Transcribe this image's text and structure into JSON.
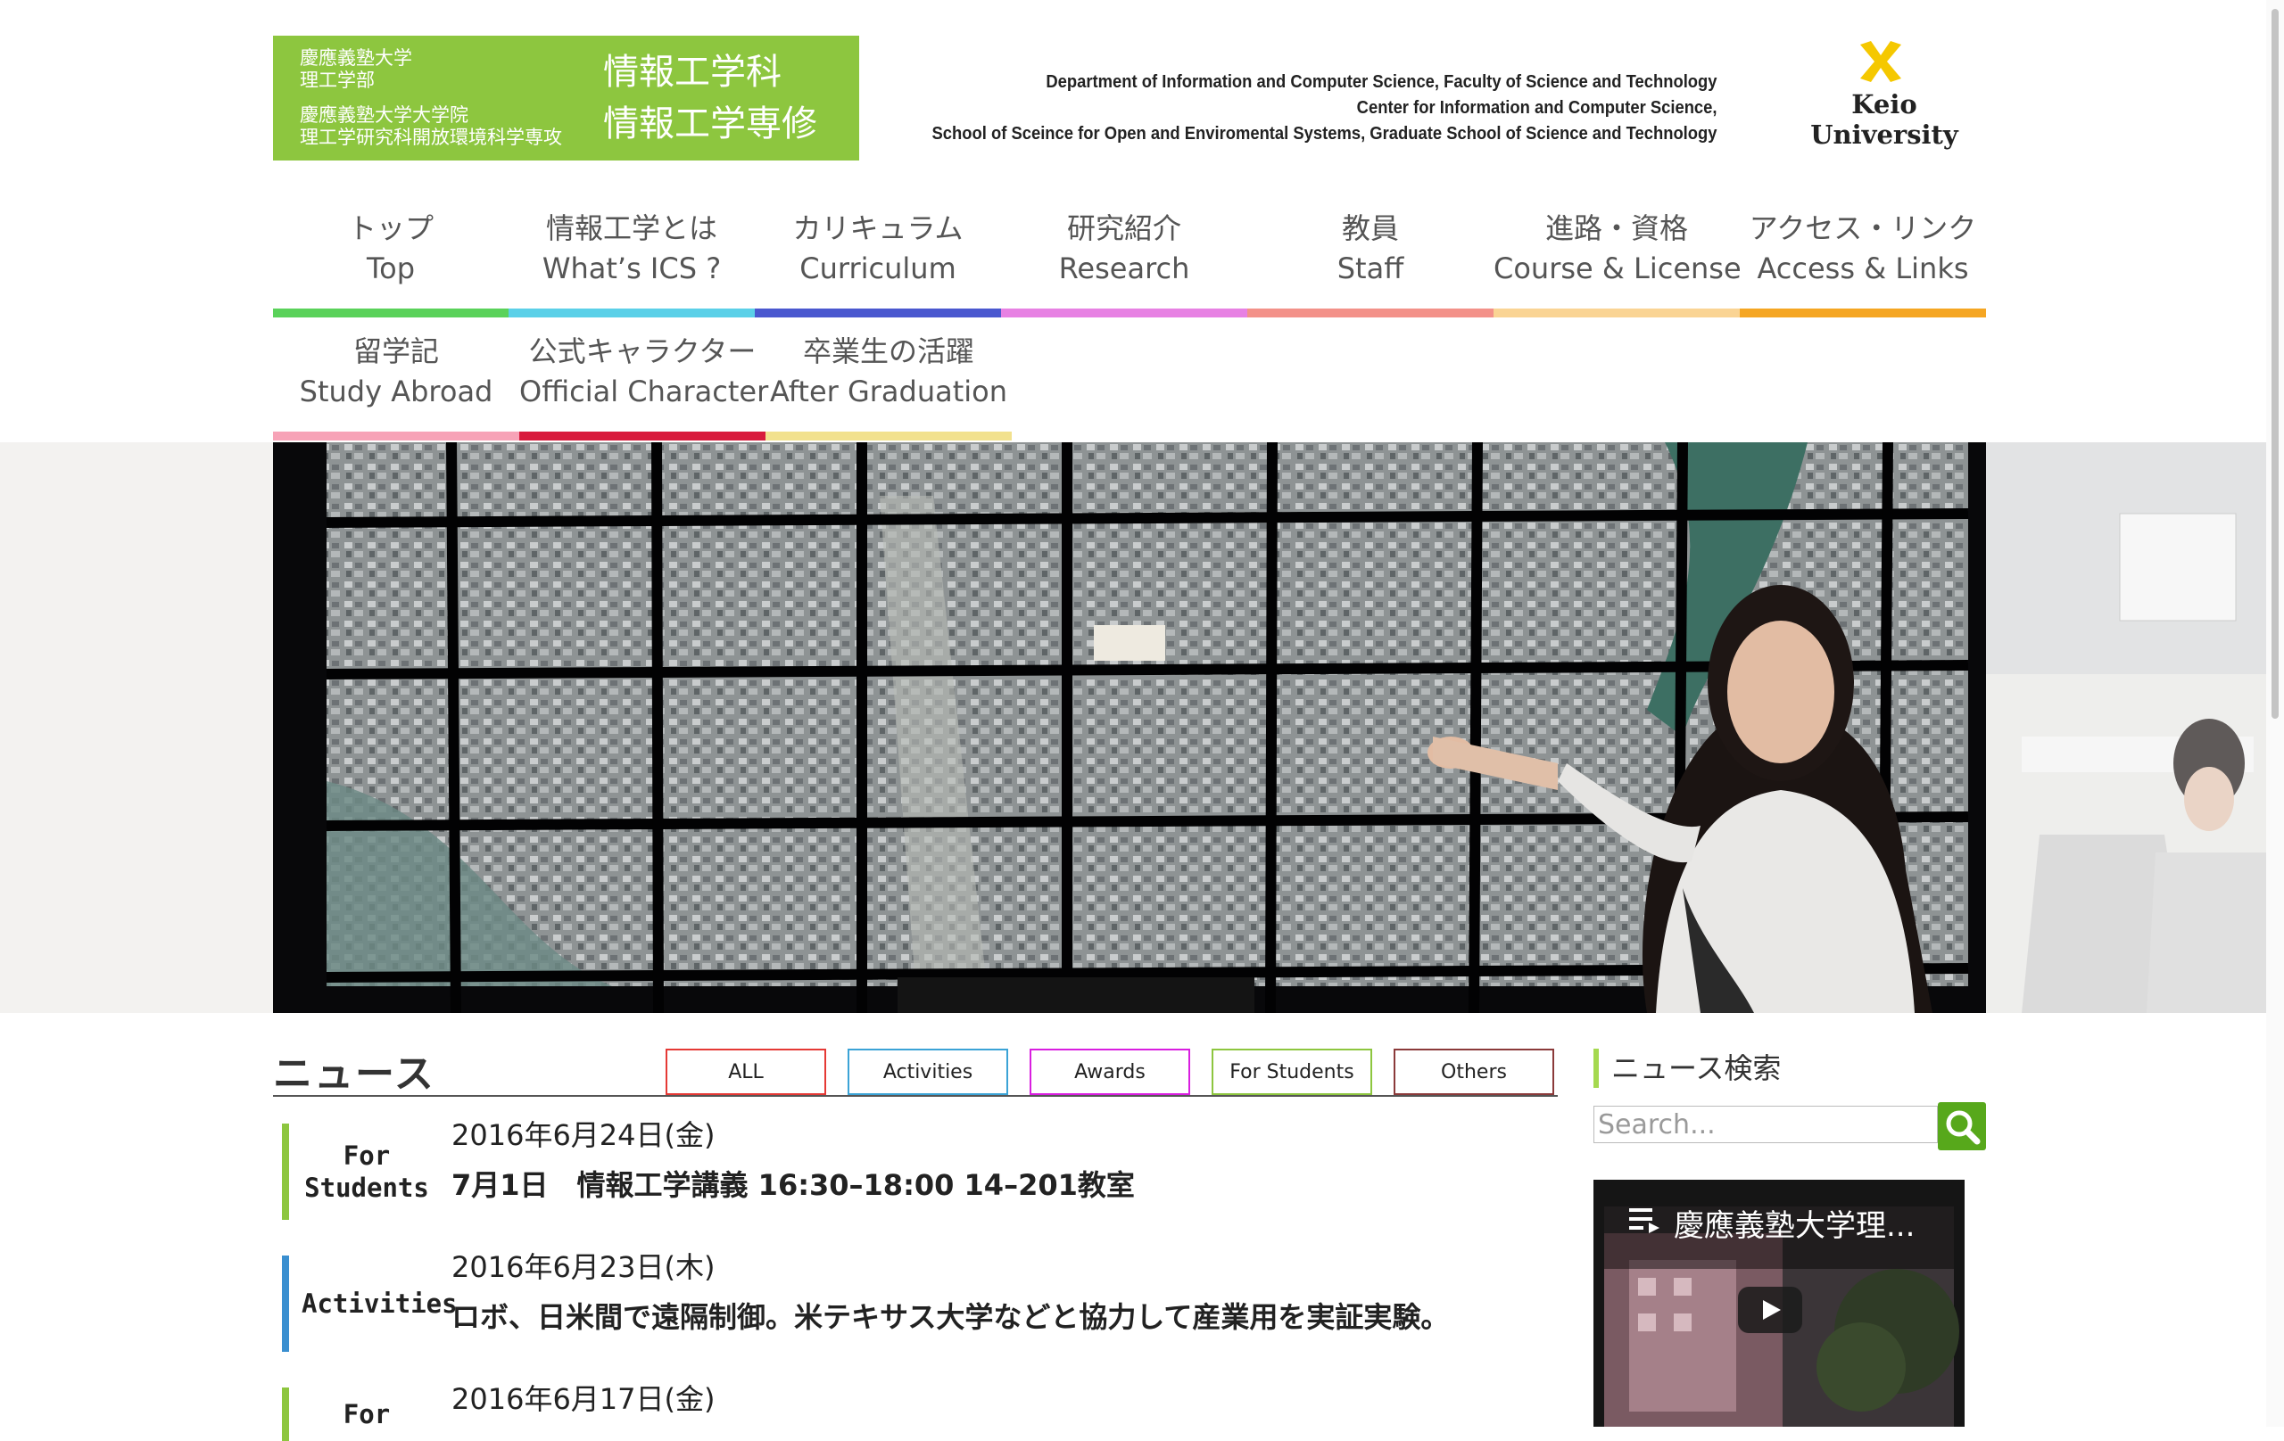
{
  "header": {
    "logo": {
      "left_lines": [
        "慶應義塾大学",
        "理工学部",
        "慶應義塾大学大学院",
        "理工学研究科開放環境科学専攻"
      ],
      "right_lines": [
        "情報工学科",
        "情報工学専修"
      ]
    },
    "department_lines": [
      "Department of Information and Computer Science, Faculty of Science and Technology",
      "Center for Information and Computer Science,",
      "School of Sceince for Open and Enviromental Systems, Graduate School of Science and Technology"
    ],
    "university": "Keio University"
  },
  "nav": [
    {
      "ja": "トップ",
      "en": "Top",
      "color": "#5ad25a"
    },
    {
      "ja": "情報工学とは",
      "en": "What’s ICS ?",
      "color": "#5bd0e8"
    },
    {
      "ja": "カリキュラム",
      "en": "Curriculum",
      "color": "#4a58cf"
    },
    {
      "ja": "研究紹介",
      "en": "Research",
      "color": "#e781e3"
    },
    {
      "ja": "教員",
      "en": "Staff",
      "color": "#f39189"
    },
    {
      "ja": "進路・資格",
      "en": "Course & License",
      "color": "#fad494"
    },
    {
      "ja": "アクセス・リンク",
      "en": "Access & Links",
      "color": "#f5a623"
    },
    {
      "ja": "留学記",
      "en": "Study Abroad",
      "color": "#f7a3b7"
    },
    {
      "ja": "公式キャラクター",
      "en": "Official Character",
      "color": "#d81b3c"
    },
    {
      "ja": "卒業生の活躍",
      "en": "After Graduation",
      "color": "#f2e18e"
    }
  ],
  "news": {
    "title": "ニュース",
    "filters": [
      {
        "label": "ALL",
        "color": "#e53935"
      },
      {
        "label": "Activities",
        "color": "#3ba3d6"
      },
      {
        "label": "Awards",
        "color": "#d91ee0"
      },
      {
        "label": "For Students",
        "color": "#8dc63f"
      },
      {
        "label": "Others",
        "color": "#8b3a3a"
      }
    ],
    "items": [
      {
        "category_lines": [
          "For",
          "Students"
        ],
        "color": "#8dc63f",
        "date": "2016年6月24日(金)",
        "text": "7月1日　情報工学講義 16:30–18:00 14–201教室"
      },
      {
        "category_lines": [
          "Activities"
        ],
        "color": "#3a8fd0",
        "date": "2016年6月23日(木)",
        "text": "ロボ、日米間で遠隔制御。米テキサス大学などと協力して産業用を実証実験。"
      },
      {
        "category_lines": [
          "For"
        ],
        "color": "#8dc63f",
        "date": "2016年6月17日(金)",
        "text": ""
      }
    ]
  },
  "sidebar": {
    "search_heading": "ニュース検索",
    "search_placeholder": "Search...",
    "search_icon": "magnifier-icon",
    "video_title": "慶應義塾大学理..."
  }
}
